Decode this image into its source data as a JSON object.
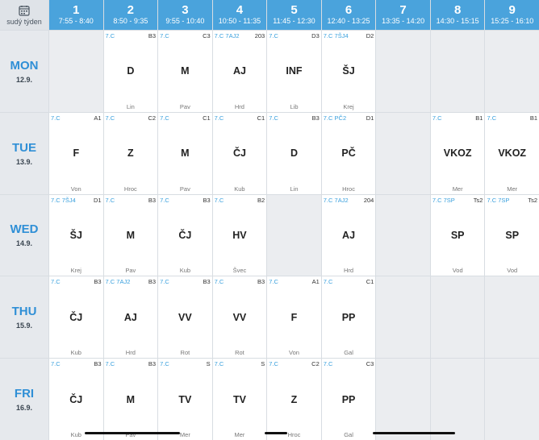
{
  "week_label": "sudý týden",
  "periods": [
    {
      "num": "1",
      "time": "7:55 - 8:40"
    },
    {
      "num": "2",
      "time": "8:50 - 9:35"
    },
    {
      "num": "3",
      "time": "9:55 - 10:40"
    },
    {
      "num": "4",
      "time": "10:50 - 11:35"
    },
    {
      "num": "5",
      "time": "11:45 - 12:30"
    },
    {
      "num": "6",
      "time": "12:40 - 13:25"
    },
    {
      "num": "7",
      "time": "13:35 - 14:20"
    },
    {
      "num": "8",
      "time": "14:30 - 15:15"
    },
    {
      "num": "9",
      "time": "15:25 - 16:10"
    }
  ],
  "days": [
    {
      "name": "MON",
      "date": "12.9.",
      "lessons": [
        null,
        {
          "group": "7.C",
          "room": "B3",
          "subject": "D",
          "teacher": "Lin"
        },
        {
          "group": "7.C",
          "room": "C3",
          "subject": "M",
          "teacher": "Pav"
        },
        {
          "group": "7.C 7AJ2",
          "room": "203",
          "subject": "AJ",
          "teacher": "Hrd"
        },
        {
          "group": "7.C",
          "room": "D3",
          "subject": "INF",
          "teacher": "Lib"
        },
        {
          "group": "7.C 7ŠJ4",
          "room": "D2",
          "subject": "ŠJ",
          "teacher": "Krej"
        },
        null,
        null,
        null
      ]
    },
    {
      "name": "TUE",
      "date": "13.9.",
      "lessons": [
        {
          "group": "7.C",
          "room": "A1",
          "subject": "F",
          "teacher": "Von"
        },
        {
          "group": "7.C",
          "room": "C2",
          "subject": "Z",
          "teacher": "Hroc"
        },
        {
          "group": "7.C",
          "room": "C1",
          "subject": "M",
          "teacher": "Pav"
        },
        {
          "group": "7.C",
          "room": "C1",
          "subject": "ČJ",
          "teacher": "Kub"
        },
        {
          "group": "7.C",
          "room": "B3",
          "subject": "D",
          "teacher": "Lin"
        },
        {
          "group": "7.C PČ2",
          "room": "D1",
          "subject": "PČ",
          "teacher": "Hroc"
        },
        null,
        {
          "group": "7.C",
          "room": "B1",
          "subject": "VKOZ",
          "teacher": "Mer"
        },
        {
          "group": "7.C",
          "room": "B1",
          "subject": "VKOZ",
          "teacher": "Mer"
        }
      ]
    },
    {
      "name": "WED",
      "date": "14.9.",
      "lessons": [
        {
          "group": "7.C 7ŠJ4",
          "room": "D1",
          "subject": "ŠJ",
          "teacher": "Krej"
        },
        {
          "group": "7.C",
          "room": "B3",
          "subject": "M",
          "teacher": "Pav"
        },
        {
          "group": "7.C",
          "room": "B3",
          "subject": "ČJ",
          "teacher": "Kub"
        },
        {
          "group": "7.C",
          "room": "B2",
          "subject": "HV",
          "teacher": "Švec"
        },
        null,
        {
          "group": "7.C 7AJ2",
          "room": "204",
          "subject": "AJ",
          "teacher": "Hrd"
        },
        null,
        {
          "group": "7.C 7SP",
          "room": "Ts2",
          "subject": "SP",
          "teacher": "Vod"
        },
        {
          "group": "7.C 7SP",
          "room": "Ts2",
          "subject": "SP",
          "teacher": "Vod"
        }
      ]
    },
    {
      "name": "THU",
      "date": "15.9.",
      "lessons": [
        {
          "group": "7.C",
          "room": "B3",
          "subject": "ČJ",
          "teacher": "Kub"
        },
        {
          "group": "7.C 7AJ2",
          "room": "B3",
          "subject": "AJ",
          "teacher": "Hrd"
        },
        {
          "group": "7.C",
          "room": "B3",
          "subject": "VV",
          "teacher": "Rot"
        },
        {
          "group": "7.C",
          "room": "B3",
          "subject": "VV",
          "teacher": "Rot"
        },
        {
          "group": "7.C",
          "room": "A1",
          "subject": "F",
          "teacher": "Von"
        },
        {
          "group": "7.C",
          "room": "C1",
          "subject": "PP",
          "teacher": "Gal"
        },
        null,
        null,
        null
      ]
    },
    {
      "name": "FRI",
      "date": "16.9.",
      "lessons": [
        {
          "group": "7.C",
          "room": "B3",
          "subject": "ČJ",
          "teacher": "Kub"
        },
        {
          "group": "7.C",
          "room": "B3",
          "subject": "M",
          "teacher": "Pav"
        },
        {
          "group": "7.C",
          "room": "S",
          "subject": "TV",
          "teacher": "Mer"
        },
        {
          "group": "7.C",
          "room": "S",
          "subject": "TV",
          "teacher": "Mer"
        },
        {
          "group": "7.C",
          "room": "C2",
          "subject": "Z",
          "teacher": "Hroc"
        },
        {
          "group": "7.C",
          "room": "C3",
          "subject": "PP",
          "teacher": "Gal"
        },
        null,
        null,
        null
      ]
    }
  ],
  "colors": {
    "header": "#4aa3dc",
    "day_label": "#2f8fd6",
    "group": "#3aa0dd",
    "empty_cell": "#ebedf0"
  }
}
